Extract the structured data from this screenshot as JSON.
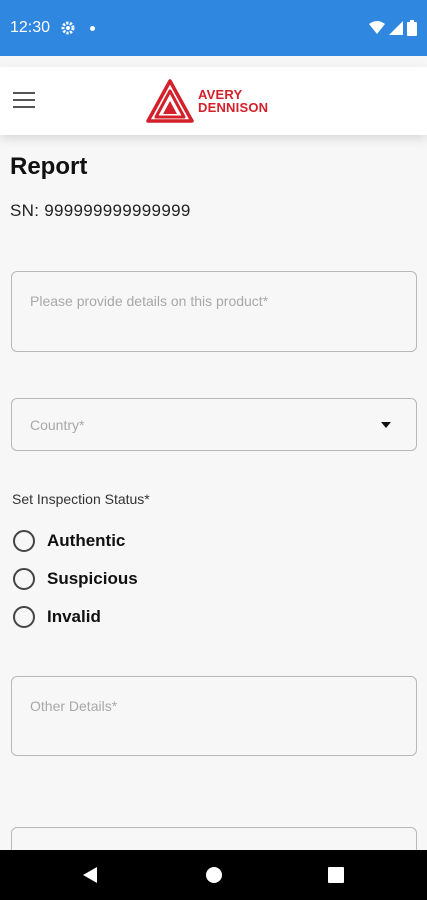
{
  "status_bar": {
    "time": "12:30",
    "icons": [
      "settings-icon",
      "notification-dot-icon",
      "wifi-icon",
      "signal-icon",
      "battery-icon"
    ]
  },
  "app_bar": {
    "menu_icon": "hamburger-menu-icon",
    "logo_line1": "AVERY",
    "logo_line2": "DENNISON",
    "brand_color": "#d3202a"
  },
  "page": {
    "title": "Report",
    "serial": "SN: 999999999999999"
  },
  "form": {
    "details_placeholder": "Please provide details on this product*",
    "country_placeholder": "Country*",
    "inspection_label": "Set Inspection Status*",
    "status_options": [
      "Authentic",
      "Suspicious",
      "Invalid"
    ],
    "other_placeholder": "Other Details*"
  },
  "nav_bar": {
    "buttons": [
      "back-icon",
      "home-icon",
      "recents-icon"
    ]
  },
  "colors": {
    "status_bar_bg": "#2f87e0",
    "page_bg": "#f7f7f7",
    "field_border": "#b8b8b8"
  }
}
